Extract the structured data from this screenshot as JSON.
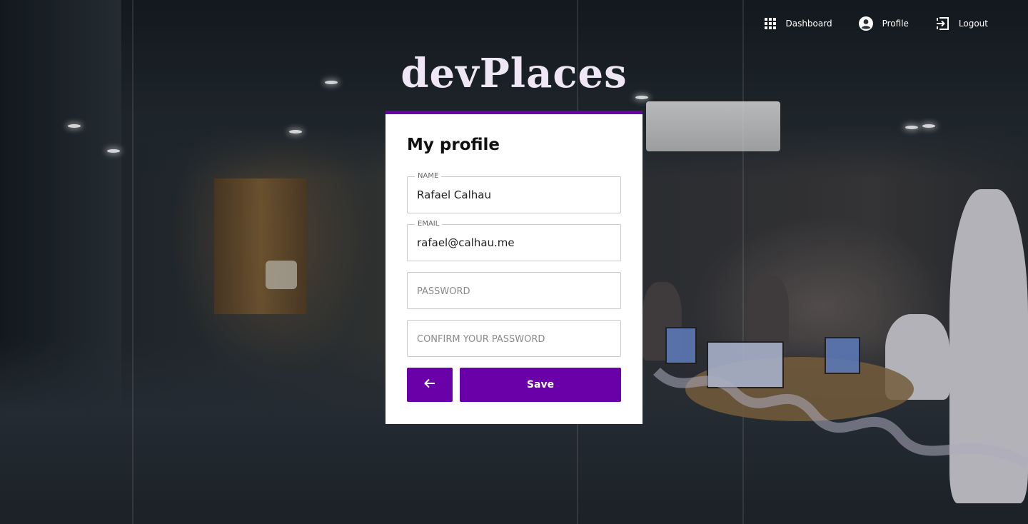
{
  "nav": {
    "items": [
      {
        "label": "Dashboard",
        "icon": "grid-icon"
      },
      {
        "label": "Profile",
        "icon": "account-circle-icon"
      },
      {
        "label": "Logout",
        "icon": "logout-icon"
      }
    ]
  },
  "brand": {
    "logo": "devPlaces"
  },
  "form": {
    "title": "My profile",
    "name": {
      "label": "NAME",
      "value": "Rafael Calhau"
    },
    "email": {
      "label": "EMAIL",
      "value": "rafael@calhau.me"
    },
    "password": {
      "placeholder": "PASSWORD"
    },
    "confirm_password": {
      "placeholder": "CONFIRM YOUR PASSWORD"
    },
    "back_icon": "arrow-left-icon",
    "save_label": "Save"
  },
  "colors": {
    "accent": "#6a00a8",
    "card": "#ffffff",
    "logo": "#efe6f6"
  }
}
